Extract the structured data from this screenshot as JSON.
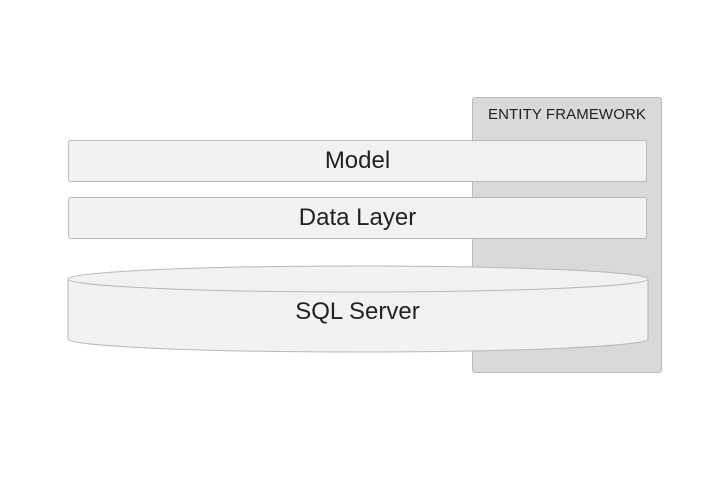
{
  "panel": {
    "label": "ENTITY FRAMEWORK",
    "fill_color": "#d9d9d9"
  },
  "layers": {
    "model": "Model",
    "data_layer": "Data Layer"
  },
  "database": {
    "label": "SQL Server",
    "fill_color": "#f2f2f2"
  }
}
